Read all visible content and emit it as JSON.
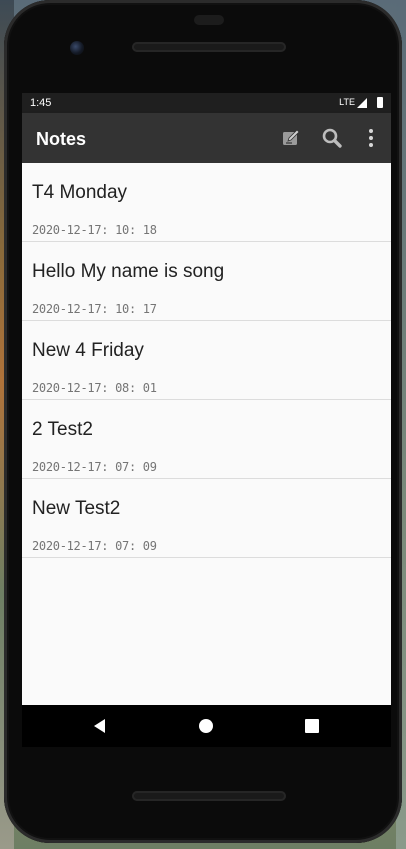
{
  "status_bar": {
    "time": "1:45",
    "network": "LTE"
  },
  "app_bar": {
    "title": "Notes",
    "actions": [
      {
        "icon": "edit-note-icon"
      },
      {
        "icon": "search-icon"
      },
      {
        "icon": "more-vert-icon"
      }
    ]
  },
  "notes": [
    {
      "title": "T4 Monday",
      "date": "2020-12-17: 10: 18"
    },
    {
      "title": "Hello My name is song",
      "date": "2020-12-17: 10: 17"
    },
    {
      "title": "New 4 Friday",
      "date": "2020-12-17: 08: 01"
    },
    {
      "title": "2 Test2",
      "date": "2020-12-17: 07: 09"
    },
    {
      "title": "New Test2",
      "date": "2020-12-17: 07: 09"
    }
  ],
  "nav_bar": {
    "buttons": [
      {
        "icon": "back-icon"
      },
      {
        "icon": "home-icon"
      },
      {
        "icon": "recents-icon"
      }
    ]
  },
  "colors": {
    "app_bar": "#333333",
    "status_bar": "#1f1f1f",
    "list_background": "#fafafa",
    "divider": "#dcdcdc",
    "date_text": "#757575"
  }
}
